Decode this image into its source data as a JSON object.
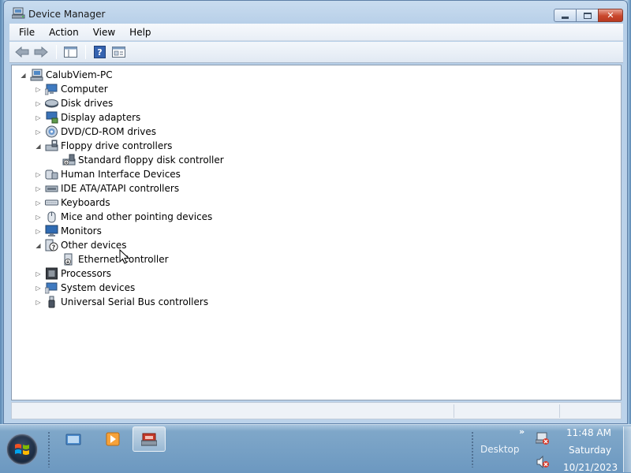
{
  "window": {
    "title": "Device Manager",
    "icon": "device-manager-icon",
    "controls": [
      "minimize-icon",
      "maximize-icon",
      "close-icon"
    ]
  },
  "menu": [
    "File",
    "Action",
    "View",
    "Help"
  ],
  "toolbar": {
    "buttons": [
      "back-arrow-icon",
      "forward-arrow-icon",
      "show-hide-console-tree-icon",
      "help-icon",
      "properties-icon"
    ]
  },
  "tree": {
    "root": "CalubViem-PC",
    "items": [
      {
        "label": "Computer",
        "icon": "computer-icon",
        "expanded": false
      },
      {
        "label": "Disk drives",
        "icon": "disk-drive-icon",
        "expanded": false
      },
      {
        "label": "Display adapters",
        "icon": "display-adapter-icon",
        "expanded": false
      },
      {
        "label": "DVD/CD-ROM drives",
        "icon": "dvd-drive-icon",
        "expanded": false
      },
      {
        "label": "Floppy drive controllers",
        "icon": "floppy-controller-icon",
        "expanded": true
      },
      {
        "label": "Standard floppy disk controller",
        "icon": "floppy-device-icon",
        "child": true
      },
      {
        "label": "Human Interface Devices",
        "icon": "hid-icon",
        "expanded": false
      },
      {
        "label": "IDE ATA/ATAPI controllers",
        "icon": "ide-controller-icon",
        "expanded": false
      },
      {
        "label": "Keyboards",
        "icon": "keyboard-icon",
        "expanded": false
      },
      {
        "label": "Mice and other pointing devices",
        "icon": "mouse-icon",
        "expanded": false
      },
      {
        "label": "Monitors",
        "icon": "monitor-icon",
        "expanded": false
      },
      {
        "label": "Other devices",
        "icon": "unknown-device-icon",
        "expanded": true
      },
      {
        "label": "Ethernet Controller",
        "icon": "ethernet-warning-icon",
        "child": true
      },
      {
        "label": "Processors",
        "icon": "processor-icon",
        "expanded": false
      },
      {
        "label": "System devices",
        "icon": "system-device-icon",
        "expanded": false
      },
      {
        "label": "Universal Serial Bus controllers",
        "icon": "usb-icon",
        "expanded": false
      }
    ]
  },
  "taskbar": {
    "start": "windows-start-orb-icon",
    "apps": [
      {
        "icon": "windows-explorer-icon",
        "active": false
      },
      {
        "icon": "media-player-icon",
        "active": false
      },
      {
        "icon": "device-manager-taskbar-icon",
        "active": true
      }
    ],
    "desktop_label": "Desktop",
    "chevron": "»",
    "tray_icons": [
      "network-disconnected-icon",
      "volume-muted-icon"
    ],
    "clock": {
      "time": "11:48 AM",
      "day": "Saturday",
      "date": "10/21/2023"
    }
  },
  "colors": {
    "title_bar": "#c9dcef",
    "taskbar": "#7fa7c9",
    "close_button": "#c9462c"
  }
}
